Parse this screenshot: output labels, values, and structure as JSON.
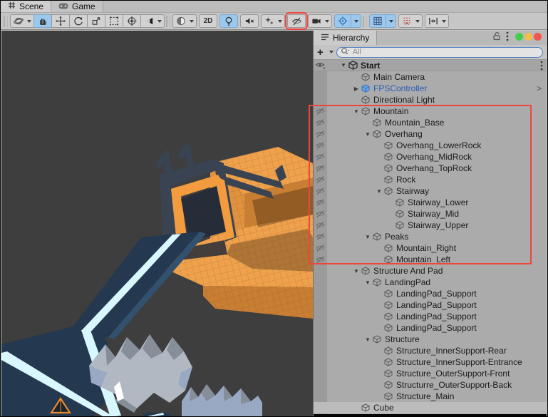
{
  "view_tabs": [
    {
      "label": "Scene",
      "active": true
    },
    {
      "label": "Game",
      "active": false
    }
  ],
  "toolbar": {
    "groups": [
      {
        "name": "transform-tools",
        "joined": true,
        "buttons": [
          {
            "name": "view-tool",
            "icon": "orbit",
            "dropdown": true
          },
          {
            "name": "hand-tool",
            "icon": "hand",
            "active": true
          },
          {
            "name": "move-tool",
            "icon": "move"
          },
          {
            "name": "rotate-tool",
            "icon": "rotate"
          },
          {
            "name": "scale-tool",
            "icon": "scale"
          },
          {
            "name": "rect-tool",
            "icon": "rect"
          },
          {
            "name": "transform-tool",
            "icon": "transform"
          },
          {
            "name": "custom-tool",
            "icon": "unity",
            "dropdown": true
          }
        ]
      },
      {
        "name": "scene-toggles",
        "joined": false,
        "buttons": [
          {
            "name": "shading-mode",
            "icon": "sphere",
            "dropdown": true
          },
          {
            "name": "2d-toggle",
            "label": "2D"
          },
          {
            "name": "lighting-toggle",
            "icon": "bulb",
            "active": true
          },
          {
            "name": "audio-toggle",
            "icon": "audio-muted"
          },
          {
            "name": "effects-toggle",
            "icon": "effects",
            "dropdown": true
          },
          {
            "name": "scene-visibility-toggle",
            "icon": "eye-hidden",
            "annotated": true
          },
          {
            "name": "camera-overlay",
            "icon": "camera",
            "dropdown": true
          },
          {
            "name": "gizmos-toggle",
            "icon": "gizmo",
            "active": true,
            "dropdown": true,
            "dropdown_active": true
          }
        ]
      },
      {
        "name": "grid-snap-tools",
        "joined": false,
        "buttons": [
          {
            "name": "grid-snapping",
            "icon": "grid",
            "active": true,
            "dropdown": true,
            "dropdown_active": true
          },
          {
            "name": "snap-increment",
            "icon": "snap",
            "dropdown": true
          },
          {
            "name": "handle-position",
            "icon": "handle",
            "dropdown": true
          }
        ]
      }
    ]
  },
  "hierarchy": {
    "tab_label": "Hierarchy",
    "create_label": "+",
    "search_placeholder": "All",
    "scene_row": {
      "name": "Start"
    },
    "traffic_lights": [
      {
        "name": "green",
        "color": "#47CD4E"
      },
      {
        "name": "yellow",
        "color": "#F5BE4A"
      },
      {
        "name": "red",
        "color": "#F2574F"
      }
    ],
    "rows": [
      {
        "name": "Main Camera",
        "level": 1
      },
      {
        "name": "FPSController",
        "level": 1,
        "arrow": "right",
        "prefab": true,
        "trailing": ">"
      },
      {
        "name": "Directional Light",
        "level": 1
      },
      {
        "name": "Mountain",
        "level": 1,
        "arrow": "down",
        "hidden": true
      },
      {
        "name": "Mountain_Base",
        "level": 2,
        "hidden": true
      },
      {
        "name": "Overhang",
        "level": 2,
        "arrow": "down",
        "hidden": true
      },
      {
        "name": "Overhang_LowerRock",
        "level": 3,
        "hidden": true
      },
      {
        "name": "Overhang_MidRock",
        "level": 3,
        "hidden": true
      },
      {
        "name": "Overhang_TopRock",
        "level": 3,
        "hidden": true
      },
      {
        "name": "Rock",
        "level": 3,
        "hidden": true
      },
      {
        "name": "Stairway",
        "level": 3,
        "arrow": "down",
        "hidden": true
      },
      {
        "name": "Stairway_Lower",
        "level": 4,
        "hidden": true
      },
      {
        "name": "Stairway_Mid",
        "level": 4,
        "hidden": true
      },
      {
        "name": "Stairway_Upper",
        "level": 4,
        "hidden": true
      },
      {
        "name": "Peaks",
        "level": 2,
        "arrow": "down",
        "hidden": true
      },
      {
        "name": "Mountain_Right",
        "level": 3,
        "hidden": true
      },
      {
        "name": "Mountain_Left",
        "level": 3,
        "hidden": true
      },
      {
        "name": "Structure And Pad",
        "level": 1,
        "arrow": "down"
      },
      {
        "name": "LandingPad",
        "level": 2,
        "arrow": "down"
      },
      {
        "name": "LandingPad_Support",
        "level": 3
      },
      {
        "name": "LandingPad_Support",
        "level": 3
      },
      {
        "name": "LandingPad_Support",
        "level": 3
      },
      {
        "name": "LandingPad_Support",
        "level": 3
      },
      {
        "name": "Structure",
        "level": 2,
        "arrow": "down"
      },
      {
        "name": "Structure_InnerSupport-Rear",
        "level": 3
      },
      {
        "name": "Structure_InnerSupport-Entrance",
        "level": 3
      },
      {
        "name": "Structure_OuterSupport-Front",
        "level": 3
      },
      {
        "name": "Structurre_OuterSupport-Back",
        "level": 3
      },
      {
        "name": "Structure_Main",
        "level": 3
      },
      {
        "name": "Cube",
        "level": 1,
        "highlight": true
      }
    ]
  },
  "annotation_color": "#F0443C",
  "scene_view": {
    "colors": {
      "bg": "#3E3E3E",
      "orange_top": "#EFA14C",
      "orange_mid": "#E0923F",
      "orange_dark": "#C97F33",
      "slate": "#3A4351",
      "slate_dark": "#262C38",
      "arch": "#F29C3F",
      "navy": "#24384F",
      "navy_light": "#32516F",
      "cyan": "#D9F7FF",
      "peak_light": "#B2B8C1",
      "peak_mid": "#868E9A",
      "peak_blue": "#9AA9C3",
      "marker": "#E98A2B"
    }
  }
}
